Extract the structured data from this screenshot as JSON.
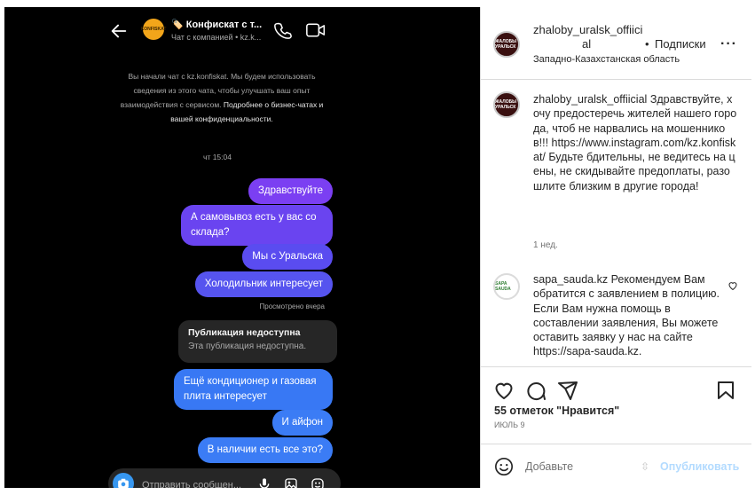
{
  "dm": {
    "title": "🏷️ Конфискат с т...",
    "subtitle": "Чат с компанией • kz.k...",
    "avatar_text": "KONFISKAT",
    "notice_text": "Вы начали чат с kz.konfiskat. Мы будем использовать сведения из этого чата, чтобы улучшать ваш опыт взаимодействия с сервисом.",
    "notice_link": "Подробнее о бизнес-чатах и вашей конфиденциальности.",
    "time": "чт 15:04",
    "messages_purple": [
      "Здравствуйте",
      "А самовывоз есть у вас со склада?",
      "Мы с Уральска",
      "Холодильник интересует"
    ],
    "seen": "Просмотрено вчера",
    "unavailable_title": "Публикация недоступна",
    "unavailable_sub": "Эта публикация недоступна.",
    "messages_blue": [
      "Ещё кондиционер и газовая плита интересует",
      "И айфон",
      "В наличии есть все это?"
    ],
    "composer_placeholder": "Отправить сообщен..."
  },
  "post": {
    "username_line1": "zhaloby_uralsk_offiici",
    "username_line2": "al",
    "dot": "•",
    "follow_label": "Подписки",
    "more": "···",
    "location": "Западно-Казахстанская область",
    "avatar_text": "ЖАЛОБЫ УРАЛЬСК",
    "caption_user": "zhaloby_uralsk_offiicial",
    "caption_text": "Здравствуйте, хочу предостеречь жителей нашего города, чтоб не нарвались на мошенников!!! https://www.instagram.com/kz.konfiskat/ Будьте бдительны, не ведитесь на цены, не скидывайте предоплаты, разошлите близким в другие города!",
    "caption_age": "1 нед.",
    "comment_user": "sapa_sauda.kz",
    "comment_text": "Рекомендуем Вам обратится с заявлением в полицию. Если Вам нужна помощь в составлении заявления, Вы можете оставить заявку у нас на сайте https://sapa-sauda.kz.",
    "comment_avatar_text": "SAPA SAUDA",
    "likes": "55 отметок \"Нравится\"",
    "date": "ИЮЛЬ 9",
    "add_comment_placeholder": "Добавьте",
    "publish_label": "Опубликовать",
    "colors": {
      "purple": "#7b3ff2",
      "blue": "#3b7cf5",
      "link_disabled": "#b3dbff"
    }
  }
}
